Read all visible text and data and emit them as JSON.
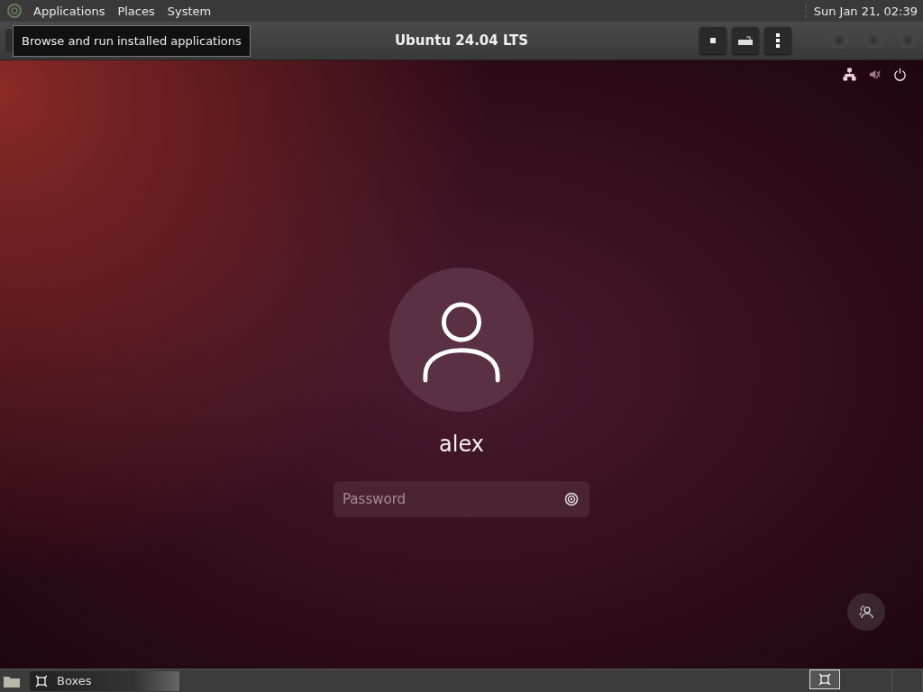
{
  "top_panel": {
    "menus": [
      "Applications",
      "Places",
      "System"
    ],
    "clock": "Sun Jan 21, 02:39"
  },
  "tooltip": "Browse and run installed applications",
  "window": {
    "title": "Ubuntu 24.04 LTS"
  },
  "login": {
    "username": "alex",
    "password": {
      "placeholder": "Password"
    }
  },
  "taskbar": {
    "tasks": [
      {
        "label": "Boxes"
      }
    ]
  }
}
